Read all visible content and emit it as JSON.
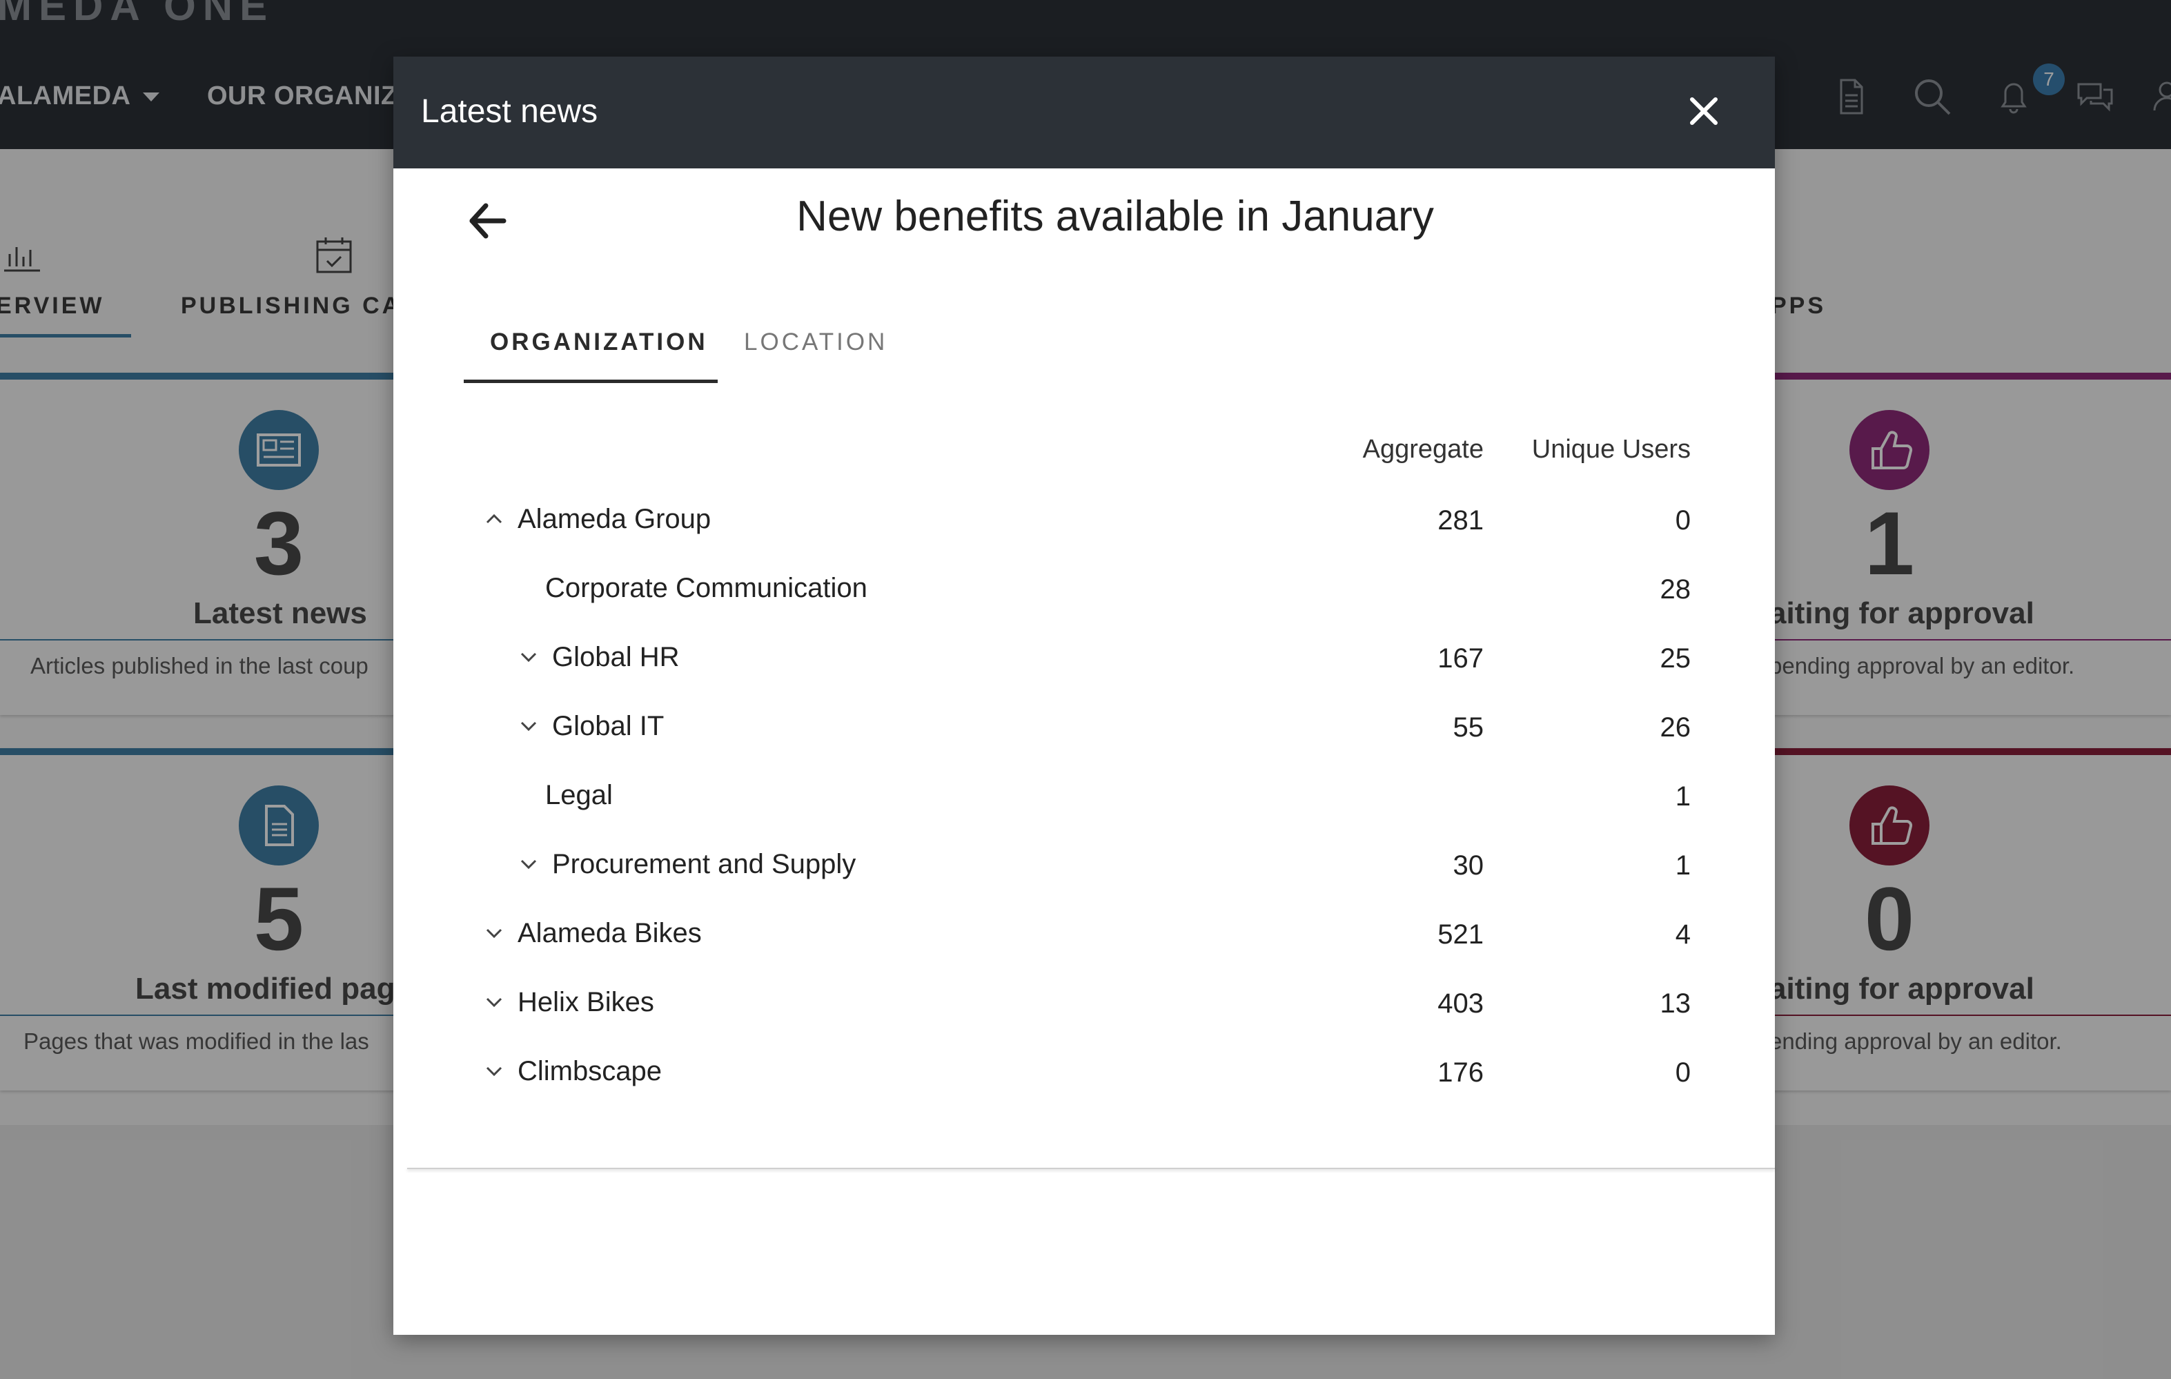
{
  "app": {
    "brand": "MEDA ONE",
    "nav": [
      {
        "label": "ALAMEDA"
      },
      {
        "label": "OUR ORGANIZA"
      }
    ],
    "notification_count": "7"
  },
  "background": {
    "tabs": [
      {
        "label": "ERVIEW"
      },
      {
        "label": "PUBLISHING CAL"
      },
      {
        "label": "PPS"
      }
    ],
    "cards": [
      {
        "number": "3",
        "title": "Latest news",
        "desc": "Articles published in the last coup",
        "accent": "#3f7fa5"
      },
      {
        "number": "1",
        "title": "aiting for approval",
        "desc": "pending approval by an editor.",
        "accent": "#8e2a7a"
      },
      {
        "number": "5",
        "title": "Last modified pag",
        "desc": "Pages that was modified in the las",
        "accent": "#3f7fa5"
      },
      {
        "number": "0",
        "title": "aiting for approval",
        "desc": "ending approval by an editor.",
        "accent": "#8a1f3a"
      }
    ]
  },
  "modal": {
    "title": "Latest news",
    "article_title": "New benefits available in January",
    "tabs": [
      {
        "label": "ORGANIZATION",
        "active": true
      },
      {
        "label": "LOCATION",
        "active": false
      }
    ],
    "columns": {
      "aggregate": "Aggregate",
      "unique": "Unique Users"
    },
    "rows": [
      {
        "label": "Alameda Group",
        "aggregate": "281",
        "unique": "0",
        "level": 0,
        "expander": "up"
      },
      {
        "label": "Corporate Communication",
        "aggregate": "",
        "unique": "28",
        "level": 1,
        "expander": "none"
      },
      {
        "label": "Global HR",
        "aggregate": "167",
        "unique": "25",
        "level": 1,
        "expander": "down"
      },
      {
        "label": "Global IT",
        "aggregate": "55",
        "unique": "26",
        "level": 1,
        "expander": "down"
      },
      {
        "label": "Legal",
        "aggregate": "",
        "unique": "1",
        "level": 1,
        "expander": "none"
      },
      {
        "label": "Procurement and Supply",
        "aggregate": "30",
        "unique": "1",
        "level": 1,
        "expander": "down"
      },
      {
        "label": "Alameda Bikes",
        "aggregate": "521",
        "unique": "4",
        "level": 0,
        "expander": "down"
      },
      {
        "label": "Helix Bikes",
        "aggregate": "403",
        "unique": "13",
        "level": 0,
        "expander": "down"
      },
      {
        "label": "Climbscape",
        "aggregate": "176",
        "unique": "0",
        "level": 0,
        "expander": "down"
      }
    ]
  }
}
